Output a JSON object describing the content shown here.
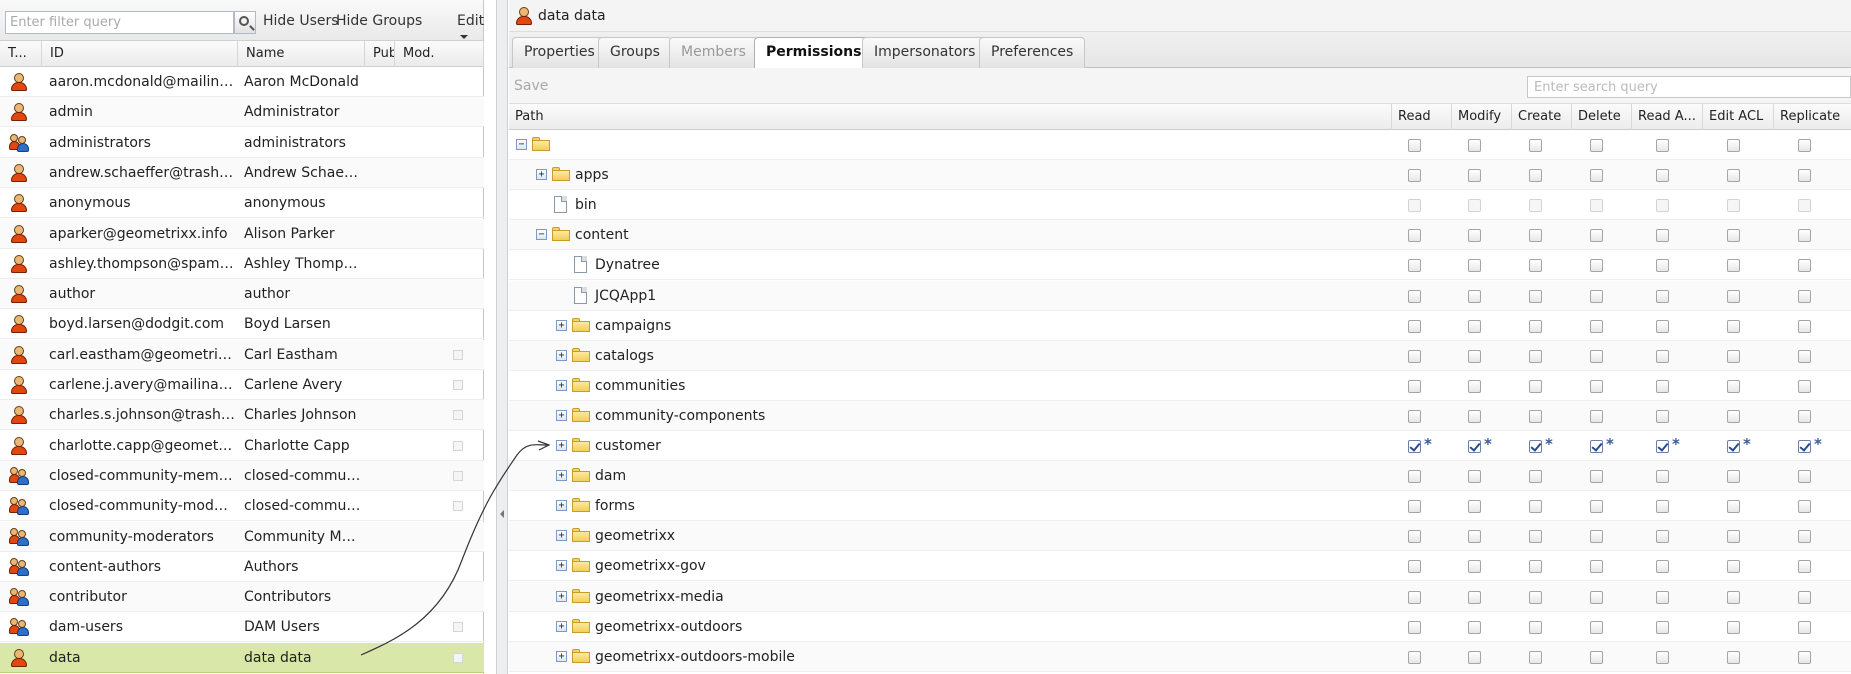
{
  "left": {
    "filter_placeholder": "Enter filter query",
    "hide_users": "Hide Users",
    "hide_groups": "Hide Groups",
    "edit": "Edit",
    "columns": [
      "T...",
      "ID",
      "Name",
      "Pub.",
      "Mod."
    ],
    "rows": [
      {
        "type": "user",
        "id": "aaron.mcdonald@mailinator...",
        "name": "Aaron McDonald",
        "mod": false
      },
      {
        "type": "user",
        "id": "admin",
        "name": "Administrator",
        "mod": false
      },
      {
        "type": "group",
        "id": "administrators",
        "name": "administrators",
        "mod": false
      },
      {
        "type": "user",
        "id": "andrew.schaeffer@trashym...",
        "name": "Andrew Schaeffer",
        "mod": false
      },
      {
        "type": "user",
        "id": "anonymous",
        "name": "anonymous",
        "mod": false
      },
      {
        "type": "user",
        "id": "aparker@geometrixx.info",
        "name": "Alison Parker",
        "mod": false
      },
      {
        "type": "user",
        "id": "ashley.thompson@spambo...",
        "name": "Ashley Thompson",
        "mod": false
      },
      {
        "type": "user",
        "id": "author",
        "name": "author",
        "mod": false
      },
      {
        "type": "user",
        "id": "boyd.larsen@dodgit.com",
        "name": "Boyd Larsen",
        "mod": false
      },
      {
        "type": "user",
        "id": "carl.eastham@geometrixx-...",
        "name": "Carl Eastham",
        "mod": true
      },
      {
        "type": "user",
        "id": "carlene.j.avery@mailinator....",
        "name": "Carlene Avery",
        "mod": true
      },
      {
        "type": "user",
        "id": "charles.s.johnson@trashym...",
        "name": "Charles Johnson",
        "mod": true
      },
      {
        "type": "user",
        "id": "charlotte.capp@geometrixx...",
        "name": "Charlotte Capp",
        "mod": true
      },
      {
        "type": "group",
        "id": "closed-community-members",
        "name": "closed-communit...",
        "mod": true
      },
      {
        "type": "group",
        "id": "closed-community-moderat...",
        "name": "closed-communit...",
        "mod": true
      },
      {
        "type": "group",
        "id": "community-moderators",
        "name": "Community Mod...",
        "mod": false
      },
      {
        "type": "group",
        "id": "content-authors",
        "name": "Authors",
        "mod": false
      },
      {
        "type": "group",
        "id": "contributor",
        "name": "Contributors",
        "mod": false
      },
      {
        "type": "group",
        "id": "dam-users",
        "name": "DAM Users",
        "mod": true
      },
      {
        "type": "user",
        "id": "data",
        "name": "data data",
        "mod": true,
        "selected": true
      }
    ]
  },
  "right": {
    "title": "data data",
    "tabs": [
      {
        "label": "Properties",
        "state": "normal"
      },
      {
        "label": "Groups",
        "state": "normal"
      },
      {
        "label": "Members",
        "state": "disabled"
      },
      {
        "label": "Permissions",
        "state": "active"
      },
      {
        "label": "Impersonators",
        "state": "normal"
      },
      {
        "label": "Preferences",
        "state": "normal"
      }
    ],
    "save": "Save",
    "search_placeholder": "Enter search query",
    "columns": {
      "path": "Path",
      "perms": [
        "Read",
        "Modify",
        "Create",
        "Delete",
        "Read A...",
        "Edit ACL",
        "Replicate"
      ]
    },
    "tree": [
      {
        "label": "",
        "depth": 0,
        "kind": "folder",
        "expander": "minus",
        "checks": "off"
      },
      {
        "label": "apps",
        "depth": 1,
        "kind": "folder",
        "expander": "plus",
        "checks": "off"
      },
      {
        "label": "bin",
        "depth": 1,
        "kind": "file",
        "expander": "none",
        "checks": "disabled"
      },
      {
        "label": "content",
        "depth": 1,
        "kind": "folder",
        "expander": "minus",
        "checks": "off"
      },
      {
        "label": "Dynatree",
        "depth": 2,
        "kind": "file",
        "expander": "none",
        "checks": "off"
      },
      {
        "label": "JCQApp1",
        "depth": 2,
        "kind": "file",
        "expander": "none",
        "checks": "off"
      },
      {
        "label": "campaigns",
        "depth": 2,
        "kind": "folder",
        "expander": "plus",
        "checks": "off"
      },
      {
        "label": "catalogs",
        "depth": 2,
        "kind": "folder",
        "expander": "plus",
        "checks": "off"
      },
      {
        "label": "communities",
        "depth": 2,
        "kind": "folder",
        "expander": "plus",
        "checks": "off"
      },
      {
        "label": "community-components",
        "depth": 2,
        "kind": "folder",
        "expander": "plus",
        "checks": "off"
      },
      {
        "label": "customer",
        "depth": 2,
        "kind": "folder",
        "expander": "plus",
        "checks": "on"
      },
      {
        "label": "dam",
        "depth": 2,
        "kind": "folder",
        "expander": "plus",
        "checks": "off"
      },
      {
        "label": "forms",
        "depth": 2,
        "kind": "folder",
        "expander": "plus",
        "checks": "off"
      },
      {
        "label": "geometrixx",
        "depth": 2,
        "kind": "folder",
        "expander": "plus",
        "checks": "off"
      },
      {
        "label": "geometrixx-gov",
        "depth": 2,
        "kind": "folder",
        "expander": "plus",
        "checks": "off"
      },
      {
        "label": "geometrixx-media",
        "depth": 2,
        "kind": "folder",
        "expander": "plus",
        "checks": "off"
      },
      {
        "label": "geometrixx-outdoors",
        "depth": 2,
        "kind": "folder",
        "expander": "plus",
        "checks": "off"
      },
      {
        "label": "geometrixx-outdoors-mobile",
        "depth": 2,
        "kind": "folder",
        "expander": "plus",
        "checks": "off"
      }
    ],
    "modified_marker": "*"
  },
  "colors": {
    "selected_row": "#d9e8a8",
    "check": "#2a4a8c"
  }
}
